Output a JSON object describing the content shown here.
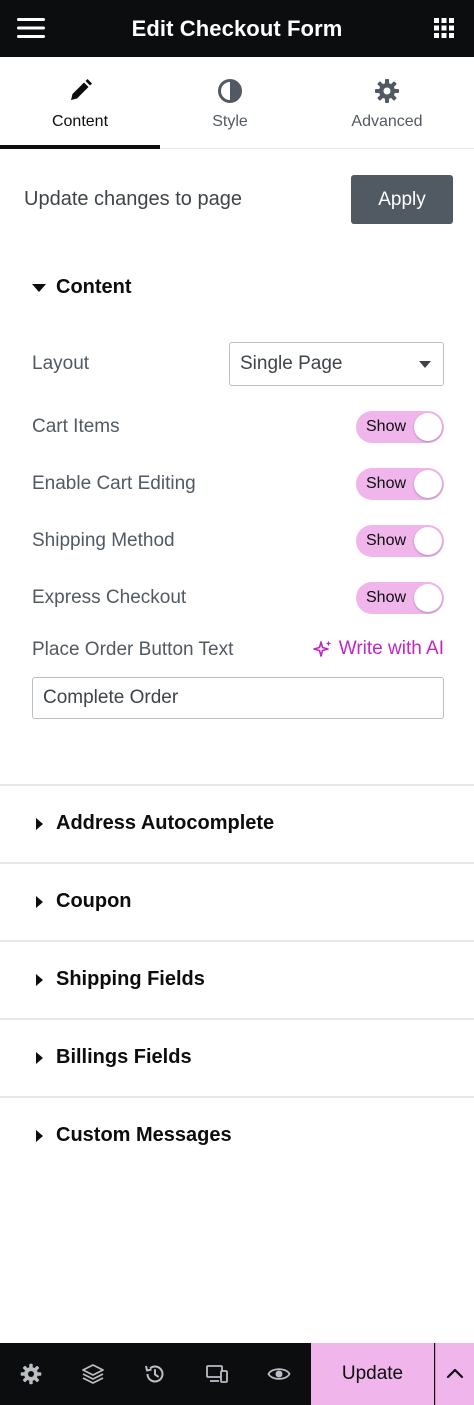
{
  "header": {
    "title": "Edit Checkout Form"
  },
  "tabs": [
    {
      "label": "Content",
      "icon": "pencil-icon",
      "active": true
    },
    {
      "label": "Style",
      "icon": "half-circle-icon",
      "active": false
    },
    {
      "label": "Advanced",
      "icon": "gear-icon",
      "active": false
    }
  ],
  "apply_bar": {
    "text": "Update changes to page",
    "button_label": "Apply"
  },
  "content_section": {
    "title": "Content",
    "layout": {
      "label": "Layout",
      "value": "Single Page"
    },
    "toggles": [
      {
        "label": "Cart Items",
        "state": "Show"
      },
      {
        "label": "Enable Cart Editing",
        "state": "Show"
      },
      {
        "label": "Shipping Method",
        "state": "Show"
      },
      {
        "label": "Express Checkout",
        "state": "Show"
      }
    ],
    "place_order": {
      "label": "Place Order Button Text",
      "ai_link": "Write with AI",
      "value": "Complete Order"
    }
  },
  "collapsed_sections": [
    {
      "title": "Address Autocomplete"
    },
    {
      "title": "Coupon"
    },
    {
      "title": "Shipping Fields"
    },
    {
      "title": "Billings Fields"
    },
    {
      "title": "Custom Messages"
    }
  ],
  "footer": {
    "update_label": "Update"
  },
  "colors": {
    "header_bg": "#0c0d0e",
    "toggle_on": "#f0b6ec",
    "accent_ai": "#c026c6",
    "apply_button": "#515962"
  }
}
